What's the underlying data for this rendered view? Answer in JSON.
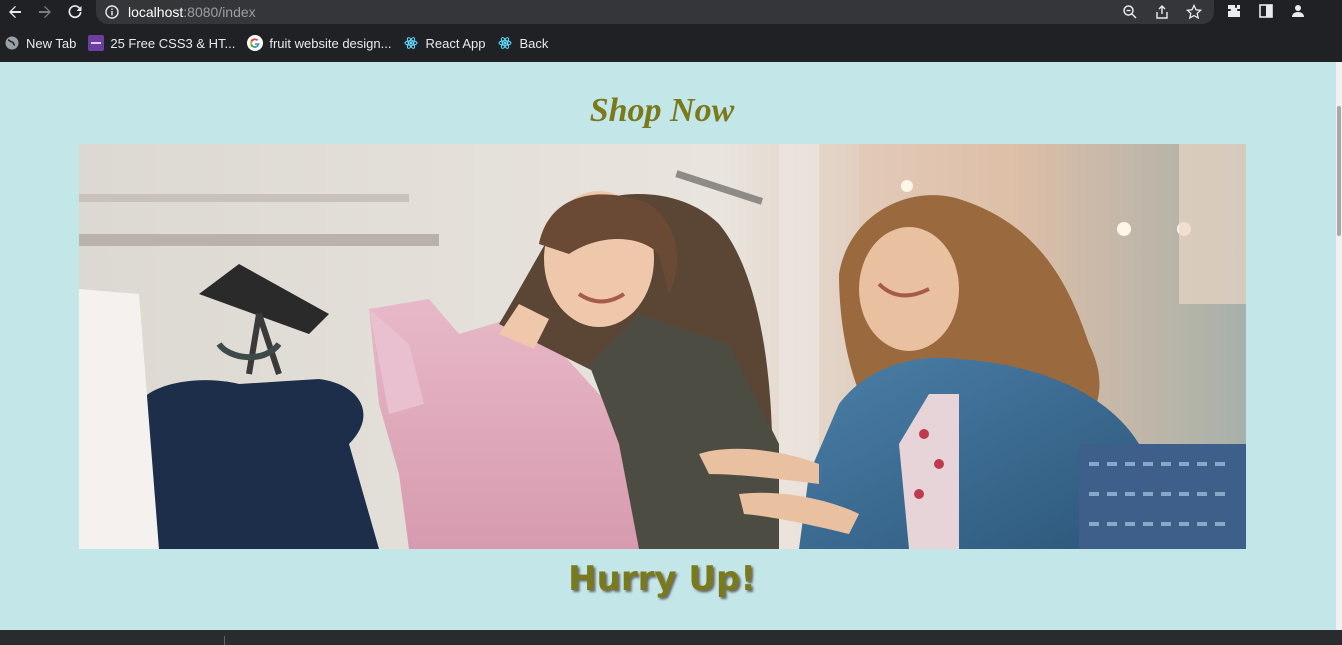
{
  "browser": {
    "url_host": "localhost",
    "url_rest": ":8080/index",
    "icons": {
      "back": "back-arrow-icon",
      "forward": "forward-arrow-icon",
      "reload": "reload-icon",
      "info": "site-info-icon",
      "zoom": "zoom-icon",
      "share": "share-icon",
      "star": "bookmark-star-icon",
      "extensions": "puzzle-icon",
      "sidepanel": "side-panel-icon",
      "profile": "profile-icon"
    },
    "bookmarks": [
      {
        "label": "New Tab",
        "icon": "globe-icon"
      },
      {
        "label": "25 Free CSS3 & HT...",
        "icon": "colorlib-icon"
      },
      {
        "label": "fruit website design...",
        "icon": "google-icon"
      },
      {
        "label": "React App",
        "icon": "react-icon"
      },
      {
        "label": "Back",
        "icon": "react-icon"
      }
    ]
  },
  "page": {
    "title": "Shop Now",
    "tagline": "Hurry Up!",
    "hero_alt": "Two women shopping for dresses in a clothing store"
  },
  "colors": {
    "page_background": "#c3e6e9",
    "heading": "#7a7a1c"
  }
}
